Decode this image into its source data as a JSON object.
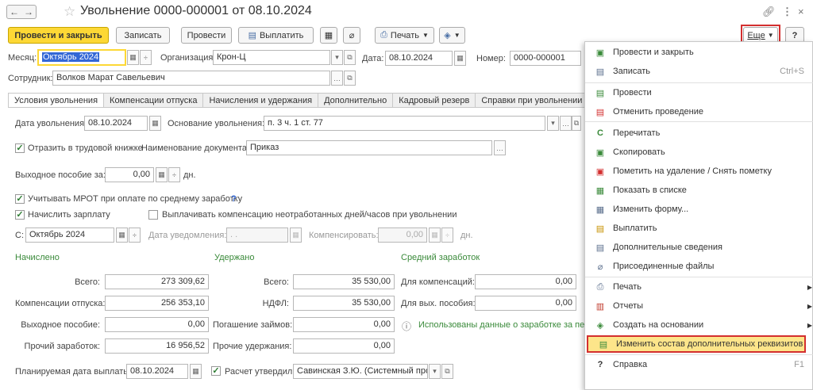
{
  "window": {
    "title": "Увольнение 0000-000001 от 08.10.2024",
    "back_icon": "arrow-left-icon",
    "fwd_icon": "arrow-right-icon",
    "link_icon": "link-icon",
    "more_icon": "vertical-dots-icon",
    "close_icon": "close-icon"
  },
  "toolbar": {
    "post_close": "Провести и закрыть",
    "save": "Записать",
    "post": "Провести",
    "pay": "Выплатить",
    "print": "Печать",
    "more": "Еще",
    "help": "?"
  },
  "header": {
    "month_label": "Месяц:",
    "month_value": "Октябрь 2024",
    "org_label": "Организация:",
    "org_value": "Крон-Ц",
    "date_label": "Дата:",
    "date_value": "08.10.2024",
    "num_label": "Номер:",
    "num_value": "0000-000001",
    "employee_label": "Сотрудник:",
    "employee_value": "Волков Марат Савельевич"
  },
  "tabs": [
    "Условия увольнения",
    "Компенсации отпуска",
    "Начисления и удержания",
    "Дополнительно",
    "Кадровый резерв",
    "Справки при увольнении"
  ],
  "conditions": {
    "dismissal_date_label": "Дата увольнения:",
    "dismissal_date": "08.10.2024",
    "reason_label": "Основание увольнения:",
    "reason_value": "п. 3 ч. 1 ст. 77",
    "workbook_label": "Отразить в трудовой книжке",
    "doc_name_label": "Наименование документа:",
    "doc_name_value": "Приказ",
    "severance_label": "Выходное пособие за:",
    "severance_value": "0,00",
    "severance_unit": "дн.",
    "mrot_label": "Учитывать МРОТ при оплате по среднему заработку",
    "mrot_help": "?",
    "accrue_label": "Начислить зарплату",
    "comp_label": "Выплачивать компенсацию неотработанных дней/часов при увольнении",
    "from_label": "С:",
    "from_value": "Октябрь 2024",
    "notice_label": "Дата уведомления:",
    "notice_value": " .  . ",
    "compensate_label": "Компенсировать:",
    "compensate_value": "0,00",
    "compensate_unit": "дн."
  },
  "accrued": {
    "title": "Начислено",
    "total_label": "Всего:",
    "total": "273 309,62",
    "vac_label": "Компенсации отпуска:",
    "vac": "256 353,10",
    "sev_label": "Выходное пособие:",
    "sev": "0,00",
    "other_label": "Прочий заработок:",
    "other": "16 956,52"
  },
  "withheld": {
    "title": "Удержано",
    "total_label": "Всего:",
    "total": "35 530,00",
    "ndfl_label": "НДФЛ:",
    "ndfl": "35 530,00",
    "loans_label": "Погашение займов:",
    "loans": "0,00",
    "other_label": "Прочие удержания:",
    "other": "0,00"
  },
  "avg": {
    "title": "Средний заработок",
    "comp_label": "Для компенсаций:",
    "comp": "0,00",
    "sev_label": "Для вых. пособия:",
    "sev": "0,00",
    "info": "Использованы данные о заработке за пери"
  },
  "footer": {
    "pay_date_label": "Планируемая дата выплаты:",
    "pay_date": "08.10.2024",
    "approved_label": "Расчет утвердил",
    "approved_value": "Савинская З.Ю. (Системный прог"
  },
  "menu": [
    {
      "label": "Провести и закрыть",
      "icon": "post-close-icon"
    },
    {
      "label": "Записать",
      "icon": "save-icon",
      "shortcut": "Ctrl+S"
    },
    {
      "label": "Провести",
      "icon": "post-icon"
    },
    {
      "label": "Отменить проведение",
      "icon": "unpost-icon"
    },
    {
      "label": "Перечитать",
      "icon": "refresh-icon"
    },
    {
      "label": "Скопировать",
      "icon": "copy-icon"
    },
    {
      "label": "Пометить на удаление / Снять пометку",
      "icon": "delete-mark-icon"
    },
    {
      "label": "Показать в списке",
      "icon": "list-icon"
    },
    {
      "label": "Изменить форму...",
      "icon": "form-icon"
    },
    {
      "label": "Выплатить",
      "icon": "pay-icon"
    },
    {
      "label": "Дополнительные сведения",
      "icon": "info-doc-icon"
    },
    {
      "label": "Присоединенные файлы",
      "icon": "paperclip-icon"
    },
    {
      "label": "Печать",
      "icon": "print-icon"
    },
    {
      "label": "Отчеты",
      "icon": "reports-icon"
    },
    {
      "label": "Создать на основании",
      "icon": "create-based-icon"
    },
    {
      "label": "Изменить состав дополнительных реквизитов",
      "icon": "edit-attributes-icon"
    },
    {
      "label": "Справка",
      "icon": "help-icon",
      "shortcut": "F1"
    }
  ]
}
